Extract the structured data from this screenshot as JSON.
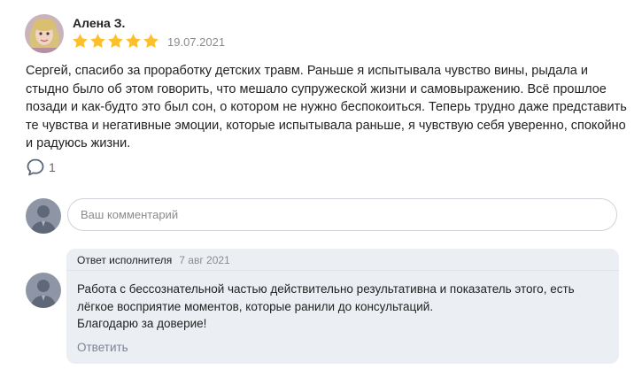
{
  "review": {
    "author": "Алена З.",
    "rating": 5,
    "date": "19.07.2021",
    "text": "Сергей, спасибо за проработку детских травм. Раньше я испытывала чувство вины, рыдала и стыдно было об этом говорить, что мешало супружеской жизни и самовыражению. Всё прошлое позади и как-будто это был сон, о котором не нужно беспокоиться. Теперь трудно даже представить те чувства и негативные эмоции, которые испытывала раньше, я чувствую себя уверенно, спокойно и радуюсь жизни.",
    "comments_count": "1",
    "star_color": "#fdc02b"
  },
  "comment_form": {
    "placeholder": "Ваш комментарий",
    "value": ""
  },
  "reply": {
    "author_label": "Ответ исполнителя",
    "date": "7 авг 2021",
    "lines": [
      "Работа с бессознательной частью действительно результативна и показатель этого, есть",
      "лёгкое восприятие моментов, которые ранили до консультаций.",
      "Благодарю за доверие!"
    ],
    "action_label": "Ответить"
  },
  "icons": {
    "star": "star-icon",
    "comment": "comment-bubble-icon",
    "avatar": "user-silhouette-icon"
  }
}
